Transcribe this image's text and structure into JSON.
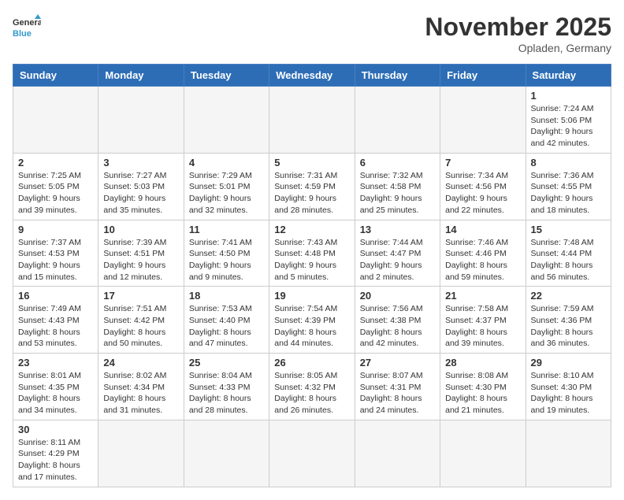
{
  "logo": {
    "text_general": "General",
    "text_blue": "Blue"
  },
  "title": "November 2025",
  "location": "Opladen, Germany",
  "days_of_week": [
    "Sunday",
    "Monday",
    "Tuesday",
    "Wednesday",
    "Thursday",
    "Friday",
    "Saturday"
  ],
  "weeks": [
    [
      {
        "day": "",
        "info": ""
      },
      {
        "day": "",
        "info": ""
      },
      {
        "day": "",
        "info": ""
      },
      {
        "day": "",
        "info": ""
      },
      {
        "day": "",
        "info": ""
      },
      {
        "day": "",
        "info": ""
      },
      {
        "day": "1",
        "info": "Sunrise: 7:24 AM\nSunset: 5:06 PM\nDaylight: 9 hours and 42 minutes."
      }
    ],
    [
      {
        "day": "2",
        "info": "Sunrise: 7:25 AM\nSunset: 5:05 PM\nDaylight: 9 hours and 39 minutes."
      },
      {
        "day": "3",
        "info": "Sunrise: 7:27 AM\nSunset: 5:03 PM\nDaylight: 9 hours and 35 minutes."
      },
      {
        "day": "4",
        "info": "Sunrise: 7:29 AM\nSunset: 5:01 PM\nDaylight: 9 hours and 32 minutes."
      },
      {
        "day": "5",
        "info": "Sunrise: 7:31 AM\nSunset: 4:59 PM\nDaylight: 9 hours and 28 minutes."
      },
      {
        "day": "6",
        "info": "Sunrise: 7:32 AM\nSunset: 4:58 PM\nDaylight: 9 hours and 25 minutes."
      },
      {
        "day": "7",
        "info": "Sunrise: 7:34 AM\nSunset: 4:56 PM\nDaylight: 9 hours and 22 minutes."
      },
      {
        "day": "8",
        "info": "Sunrise: 7:36 AM\nSunset: 4:55 PM\nDaylight: 9 hours and 18 minutes."
      }
    ],
    [
      {
        "day": "9",
        "info": "Sunrise: 7:37 AM\nSunset: 4:53 PM\nDaylight: 9 hours and 15 minutes."
      },
      {
        "day": "10",
        "info": "Sunrise: 7:39 AM\nSunset: 4:51 PM\nDaylight: 9 hours and 12 minutes."
      },
      {
        "day": "11",
        "info": "Sunrise: 7:41 AM\nSunset: 4:50 PM\nDaylight: 9 hours and 9 minutes."
      },
      {
        "day": "12",
        "info": "Sunrise: 7:43 AM\nSunset: 4:48 PM\nDaylight: 9 hours and 5 minutes."
      },
      {
        "day": "13",
        "info": "Sunrise: 7:44 AM\nSunset: 4:47 PM\nDaylight: 9 hours and 2 minutes."
      },
      {
        "day": "14",
        "info": "Sunrise: 7:46 AM\nSunset: 4:46 PM\nDaylight: 8 hours and 59 minutes."
      },
      {
        "day": "15",
        "info": "Sunrise: 7:48 AM\nSunset: 4:44 PM\nDaylight: 8 hours and 56 minutes."
      }
    ],
    [
      {
        "day": "16",
        "info": "Sunrise: 7:49 AM\nSunset: 4:43 PM\nDaylight: 8 hours and 53 minutes."
      },
      {
        "day": "17",
        "info": "Sunrise: 7:51 AM\nSunset: 4:42 PM\nDaylight: 8 hours and 50 minutes."
      },
      {
        "day": "18",
        "info": "Sunrise: 7:53 AM\nSunset: 4:40 PM\nDaylight: 8 hours and 47 minutes."
      },
      {
        "day": "19",
        "info": "Sunrise: 7:54 AM\nSunset: 4:39 PM\nDaylight: 8 hours and 44 minutes."
      },
      {
        "day": "20",
        "info": "Sunrise: 7:56 AM\nSunset: 4:38 PM\nDaylight: 8 hours and 42 minutes."
      },
      {
        "day": "21",
        "info": "Sunrise: 7:58 AM\nSunset: 4:37 PM\nDaylight: 8 hours and 39 minutes."
      },
      {
        "day": "22",
        "info": "Sunrise: 7:59 AM\nSunset: 4:36 PM\nDaylight: 8 hours and 36 minutes."
      }
    ],
    [
      {
        "day": "23",
        "info": "Sunrise: 8:01 AM\nSunset: 4:35 PM\nDaylight: 8 hours and 34 minutes."
      },
      {
        "day": "24",
        "info": "Sunrise: 8:02 AM\nSunset: 4:34 PM\nDaylight: 8 hours and 31 minutes."
      },
      {
        "day": "25",
        "info": "Sunrise: 8:04 AM\nSunset: 4:33 PM\nDaylight: 8 hours and 28 minutes."
      },
      {
        "day": "26",
        "info": "Sunrise: 8:05 AM\nSunset: 4:32 PM\nDaylight: 8 hours and 26 minutes."
      },
      {
        "day": "27",
        "info": "Sunrise: 8:07 AM\nSunset: 4:31 PM\nDaylight: 8 hours and 24 minutes."
      },
      {
        "day": "28",
        "info": "Sunrise: 8:08 AM\nSunset: 4:30 PM\nDaylight: 8 hours and 21 minutes."
      },
      {
        "day": "29",
        "info": "Sunrise: 8:10 AM\nSunset: 4:30 PM\nDaylight: 8 hours and 19 minutes."
      }
    ],
    [
      {
        "day": "30",
        "info": "Sunrise: 8:11 AM\nSunset: 4:29 PM\nDaylight: 8 hours and 17 minutes."
      },
      {
        "day": "",
        "info": ""
      },
      {
        "day": "",
        "info": ""
      },
      {
        "day": "",
        "info": ""
      },
      {
        "day": "",
        "info": ""
      },
      {
        "day": "",
        "info": ""
      },
      {
        "day": "",
        "info": ""
      }
    ]
  ]
}
